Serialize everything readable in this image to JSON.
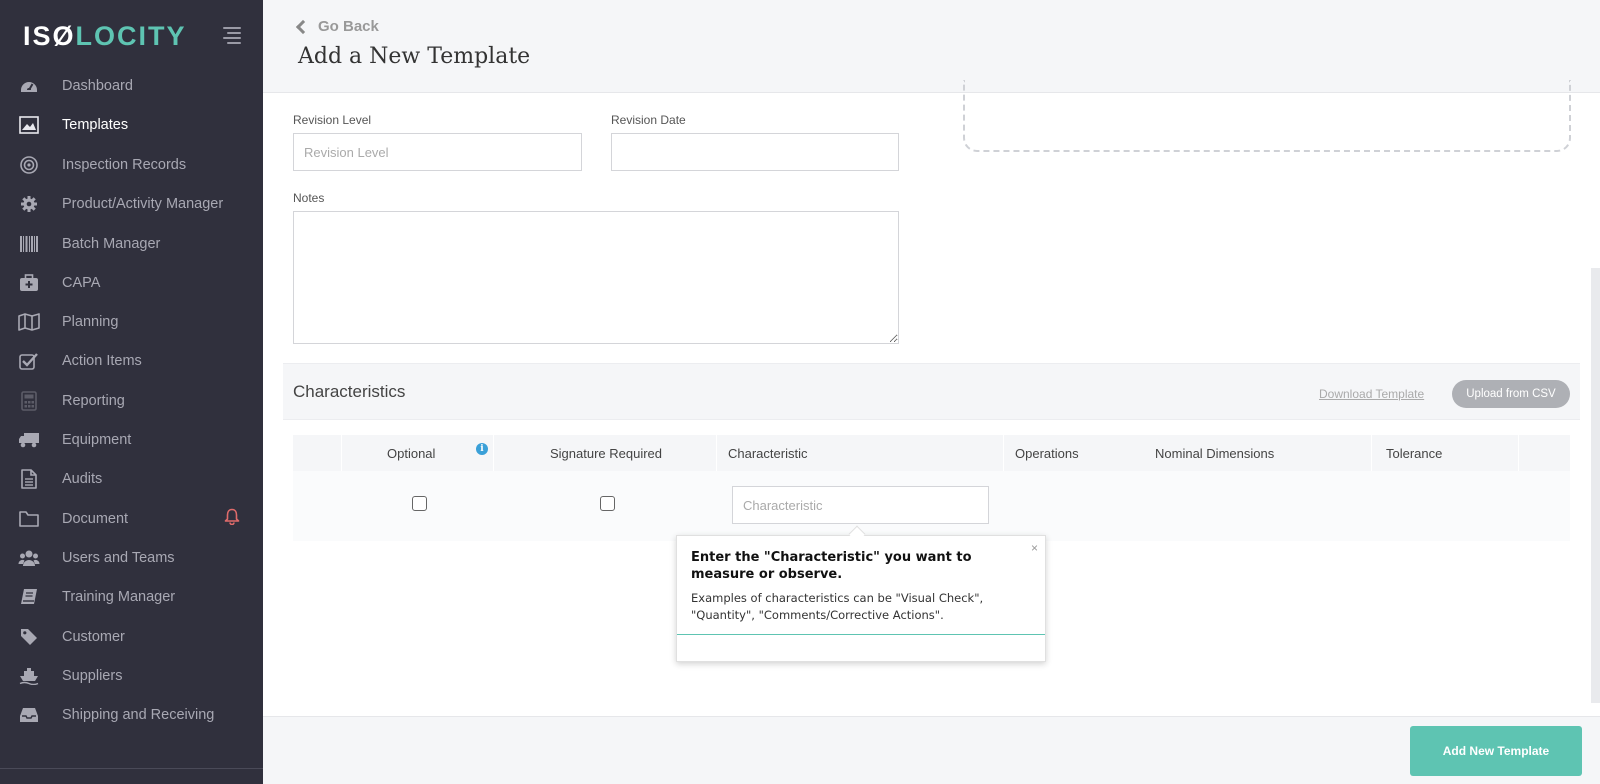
{
  "app": {
    "logo_part1": "ISØ",
    "logo_part2": "LOCITY",
    "brand_color": "#5ec4b2"
  },
  "sidebar": {
    "items": [
      {
        "label": "Dashboard",
        "icon": "dashboard-icon"
      },
      {
        "label": "Templates",
        "icon": "image-icon",
        "active": true
      },
      {
        "label": "Inspection Records",
        "icon": "target-icon"
      },
      {
        "label": "Product/Activity Manager",
        "icon": "gear-icon"
      },
      {
        "label": "Batch Manager",
        "icon": "barcode-icon"
      },
      {
        "label": "CAPA",
        "icon": "medkit-icon"
      },
      {
        "label": "Planning",
        "icon": "map-icon"
      },
      {
        "label": "Action Items",
        "icon": "checkbox-icon"
      },
      {
        "label": "Reporting",
        "icon": "calculator-icon"
      },
      {
        "label": "Equipment",
        "icon": "truck-icon"
      },
      {
        "label": "Audits",
        "icon": "file-icon"
      },
      {
        "label": "Document",
        "icon": "folder-icon"
      },
      {
        "label": "Users and Teams",
        "icon": "users-icon"
      },
      {
        "label": "Training Manager",
        "icon": "book-icon"
      },
      {
        "label": "Customer",
        "icon": "tag-icon"
      },
      {
        "label": "Suppliers",
        "icon": "ship-icon"
      },
      {
        "label": "Shipping and Receiving",
        "icon": "inbox-icon"
      }
    ]
  },
  "header": {
    "back_label": "Go Back",
    "title": "Add a New Template"
  },
  "form": {
    "revision_level_label": "Revision Level",
    "revision_level_placeholder": "Revision Level",
    "revision_level_value": "",
    "revision_date_label": "Revision Date",
    "revision_date_value": "",
    "notes_label": "Notes",
    "notes_value": ""
  },
  "characteristics": {
    "title": "Characteristics",
    "download_label": "Download Template",
    "upload_label": "Upload from CSV",
    "columns": [
      "Optional",
      "Signature Required",
      "Characteristic",
      "Operations",
      "Nominal Dimensions",
      "Tolerance"
    ],
    "row": {
      "optional_checked": false,
      "signature_checked": false,
      "characteristic_placeholder": "Characteristic",
      "characteristic_value": ""
    }
  },
  "tooltip": {
    "title": "Enter the \"Characteristic\" you want to measure or observe.",
    "body": "Examples of characteristics can be \"Visual Check\", \"Quantity\", \"Comments/Corrective Actions\".",
    "close": "×"
  },
  "footer": {
    "submit_label": "Add New Template"
  }
}
